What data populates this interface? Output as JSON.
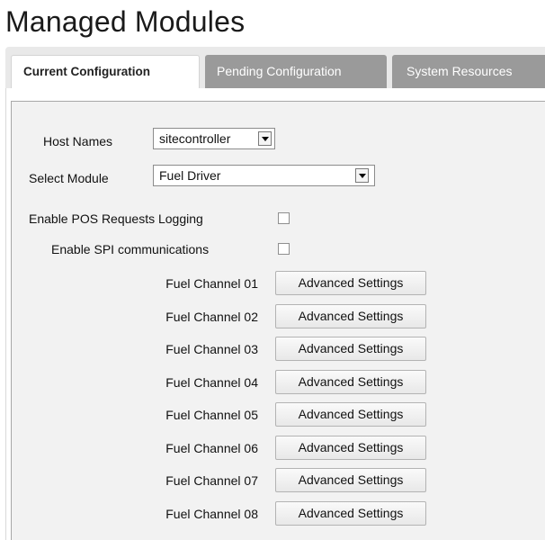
{
  "page": {
    "title": "Managed Modules"
  },
  "tabs": {
    "current": "Current Configuration",
    "pending": "Pending Configuration",
    "resources": "System Resources"
  },
  "form": {
    "host_names_label": "Host Names",
    "host_names_value": "sitecontroller",
    "select_module_label": "Select Module",
    "select_module_value": "Fuel Driver",
    "pos_logging_label": "Enable POS Requests Logging",
    "pos_logging_checked": false,
    "spi_label": "Enable SPI communications",
    "spi_checked": false
  },
  "channels": [
    {
      "label": "Fuel Channel 01",
      "button": "Advanced Settings"
    },
    {
      "label": "Fuel Channel 02",
      "button": "Advanced Settings"
    },
    {
      "label": "Fuel Channel 03",
      "button": "Advanced Settings"
    },
    {
      "label": "Fuel Channel 04",
      "button": "Advanced Settings"
    },
    {
      "label": "Fuel Channel 05",
      "button": "Advanced Settings"
    },
    {
      "label": "Fuel Channel 06",
      "button": "Advanced Settings"
    },
    {
      "label": "Fuel Channel 07",
      "button": "Advanced Settings"
    },
    {
      "label": "Fuel Channel 08",
      "button": "Advanced Settings"
    }
  ],
  "icons": {
    "dropdown": "chevron-down-icon"
  },
  "colors": {
    "active_tab_bg": "#ffffff",
    "inactive_tab_bg": "#9a9a9a",
    "tab_strip_bg": "#e9e9e9",
    "panel_bg": "#f2f2f2"
  }
}
